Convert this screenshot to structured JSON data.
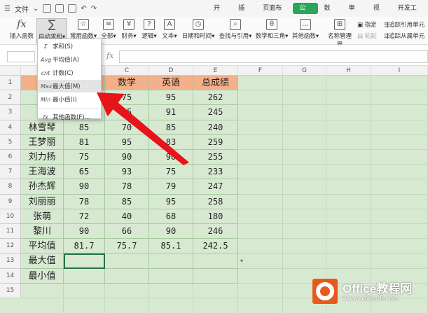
{
  "topbar": {
    "menu_label": "文件",
    "tabs": [
      "开始",
      "插入",
      "页面布局",
      "公式",
      "数据",
      "审阅",
      "视图",
      "开发工具"
    ],
    "active_tab": "公式"
  },
  "ribbon": {
    "insert_function": "插入函数",
    "autosum": "自动求和",
    "common_functions": "常用函数",
    "all": "全部",
    "finance": "财务",
    "logic": "逻辑",
    "text": "文本",
    "datetime": "日期和时间",
    "lookup": "查找与引用",
    "math": "数学和三角",
    "other_functions": "其他函数",
    "name_manager": "名称管理器",
    "define": "指定",
    "paste": "粘贴",
    "trace_precedents": "追踪引用单元",
    "trace_dependents": "追踪从属单元"
  },
  "formula_bar": {
    "fx_label": "fx"
  },
  "dropdown": {
    "items": [
      {
        "icon": "Σ",
        "label": "求和(S)"
      },
      {
        "icon": "Avg",
        "label": "平均值(A)"
      },
      {
        "icon": "cnt",
        "label": "计数(C)"
      },
      {
        "icon": "Max",
        "label": "最大值(M)"
      },
      {
        "icon": "Min",
        "label": "最小值(I)"
      },
      {
        "icon": "fx",
        "label": "其他函数(F)..."
      }
    ],
    "highlighted_index": 3
  },
  "grid": {
    "columns": [
      "A",
      "B",
      "C",
      "D",
      "E",
      "F",
      "G",
      "H",
      "I"
    ],
    "rows": [
      "1",
      "2",
      "3",
      "4",
      "5",
      "6",
      "7",
      "8",
      "9",
      "10",
      "11",
      "12",
      "13",
      "14",
      "15"
    ],
    "visible_cells": [
      [
        "姓",
        "",
        "数学",
        "英语",
        "总成绩"
      ],
      [
        "张",
        "",
        "75",
        "95",
        "262"
      ],
      [
        "刘",
        "",
        "65",
        "91",
        "245"
      ],
      [
        "林雪琴",
        "85",
        "70",
        "85",
        "240"
      ],
      [
        "王梦丽",
        "81",
        "95",
        "83",
        "259"
      ],
      [
        "刘力扬",
        "75",
        "90",
        "90",
        "255"
      ],
      [
        "王海波",
        "65",
        "93",
        "75",
        "233"
      ],
      [
        "孙杰辉",
        "90",
        "78",
        "79",
        "247"
      ],
      [
        "刘丽丽",
        "78",
        "85",
        "95",
        "258"
      ],
      [
        "张萌",
        "72",
        "40",
        "68",
        "180"
      ],
      [
        "黎川",
        "90",
        "66",
        "90",
        "246"
      ],
      [
        "平均值",
        "81.7",
        "75.7",
        "85.1",
        "242.5"
      ],
      [
        "最大值",
        "",
        "",
        "",
        ""
      ],
      [
        "最小值",
        "",
        "",
        "",
        ""
      ]
    ]
  },
  "watermark": {
    "brand": "Office教程网",
    "url": "www.office26.com"
  }
}
